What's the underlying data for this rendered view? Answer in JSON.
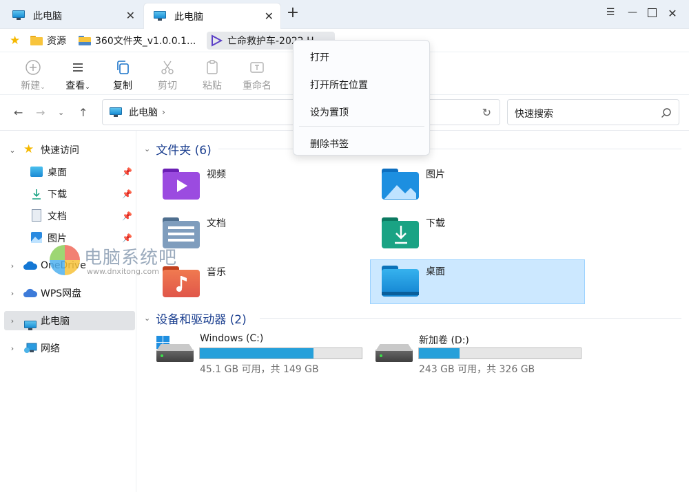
{
  "tabs": [
    {
      "label": "此电脑",
      "active": false
    },
    {
      "label": "此电脑",
      "active": true
    }
  ],
  "bookmarks": [
    {
      "label": "资源",
      "icon": "folder-icon"
    },
    {
      "label": "360文件夹_v1.0.0.1...",
      "icon": "drive-folder-icon"
    },
    {
      "label": "亡命救护车-2022 H...",
      "icon": "video-icon"
    }
  ],
  "toolbar": {
    "new": "新建",
    "view": "查看",
    "copy": "复制",
    "cut": "剪切",
    "paste": "粘贴",
    "rename": "重命名"
  },
  "address": {
    "crumb": "此电脑",
    "search_placeholder": "快速搜索"
  },
  "sidebar": {
    "quick_access": "快速访问",
    "items": [
      {
        "label": "桌面",
        "icon": "desktop-icon"
      },
      {
        "label": "下载",
        "icon": "download-icon"
      },
      {
        "label": "文档",
        "icon": "document-icon"
      },
      {
        "label": "图片",
        "icon": "picture-icon"
      }
    ],
    "onedrive": "OneDrive",
    "wps": "WPS网盘",
    "this_pc": "此电脑",
    "network": "网络"
  },
  "main": {
    "folders_header": "文件夹 (6)",
    "folders": [
      {
        "label": "视频",
        "color": "#8a3bd6"
      },
      {
        "label": "图片",
        "color": "#1d8fe0"
      },
      {
        "label": "文档",
        "color": "#6f8fae"
      },
      {
        "label": "下载",
        "color": "#1aa384"
      },
      {
        "label": "音乐",
        "color": "#e96a4a"
      },
      {
        "label": "桌面",
        "color": "#1a9be3"
      }
    ],
    "drives_header": "设备和驱动器 (2)",
    "drives": [
      {
        "label": "Windows (C:)",
        "usage": "45.1 GB 可用，共 149 GB",
        "used_fraction": 0.7
      },
      {
        "label": "新加卷 (D:)",
        "usage": "243 GB 可用，共 326 GB",
        "used_fraction": 0.25
      }
    ]
  },
  "context_menu": {
    "items": [
      "打开",
      "打开所在位置",
      "设为置顶"
    ],
    "delete": "删除书签"
  },
  "watermark": {
    "title": "电脑系统吧",
    "url": "www.dnxitong.com"
  }
}
